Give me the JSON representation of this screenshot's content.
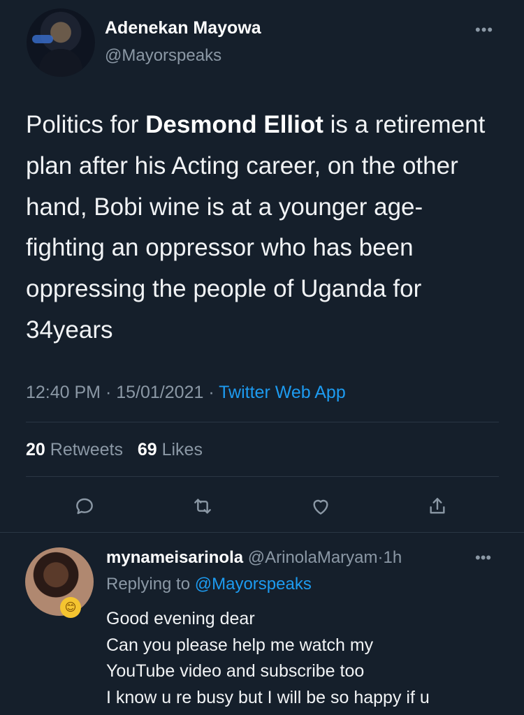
{
  "tweet": {
    "author_name": "Adenekan Mayowa",
    "author_handle": "@Mayorspeaks",
    "more_icon": "more-horizontal-icon",
    "text_parts": [
      "Politics for ",
      "Desmond Elliot",
      " is a retirement plan after his Acting career, on the other hand, Bobi wine is at a younger age-fighting an oppressor who has been oppressing the people of Uganda for 34years"
    ],
    "time": "12:40 PM",
    "date": "15/01/2021",
    "separator": "·",
    "source": "Twitter Web App",
    "retweets_count": "20",
    "retweets_label": "Retweets",
    "likes_count": "69",
    "likes_label": "Likes"
  },
  "actions": [
    {
      "name": "reply",
      "icon": "reply-icon"
    },
    {
      "name": "retweet",
      "icon": "retweet-icon"
    },
    {
      "name": "like",
      "icon": "heart-icon"
    },
    {
      "name": "share",
      "icon": "share-icon"
    }
  ],
  "reply": {
    "name": "mynameisarinola",
    "handle": "@ArinolaMaryam",
    "separator": "·",
    "time": "1h",
    "replying_label": "Replying to",
    "replying_to": "@Mayorspeaks",
    "lines": [
      "Good evening dear",
      "Can you please help me watch my",
      "YouTube video and subscribe too",
      "I know u re busy but I will be so happy if u"
    ],
    "emoji": "😊"
  },
  "colors": {
    "background": "#151f2b",
    "link": "#1d9bf0",
    "secondary_text": "#8b98a5",
    "primary_text": "#f1f3f5"
  }
}
